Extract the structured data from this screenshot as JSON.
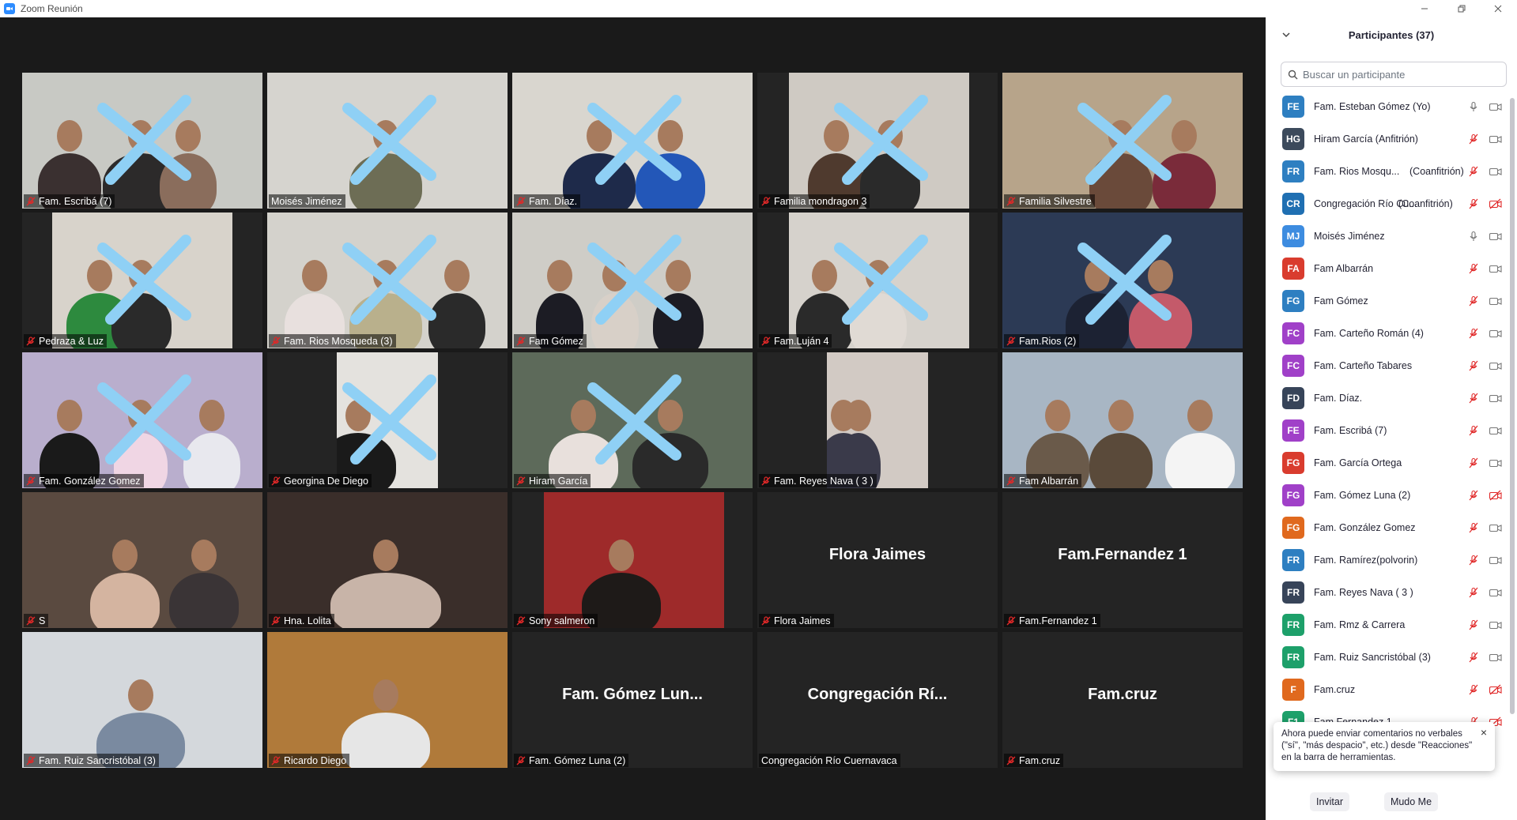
{
  "window": {
    "title": "Zoom Reunión"
  },
  "tiles": [
    {
      "label": "Fam. Escribá (7)",
      "muted": true,
      "kind": "video"
    },
    {
      "label": "Moisés Jiménez",
      "muted": false,
      "kind": "video"
    },
    {
      "label": "Fam. Díaz.",
      "muted": true,
      "kind": "video"
    },
    {
      "label": "Familia mondragon 3",
      "muted": true,
      "kind": "video"
    },
    {
      "label": "Familia  Silvestre",
      "muted": true,
      "kind": "video"
    },
    {
      "label": "Pedraza & Luz",
      "muted": true,
      "kind": "video"
    },
    {
      "label": "Fam. Rios Mosqueda (3)",
      "muted": true,
      "kind": "video"
    },
    {
      "label": "Fam Gómez",
      "muted": true,
      "kind": "video"
    },
    {
      "label": "Fam.Luján 4",
      "muted": true,
      "kind": "video"
    },
    {
      "label": "Fam.Rios (2)",
      "muted": true,
      "kind": "video"
    },
    {
      "label": "Fam. González Gomez",
      "muted": true,
      "kind": "video"
    },
    {
      "label": "Georgina De Diego",
      "muted": true,
      "kind": "video"
    },
    {
      "label": "Hiram García",
      "muted": true,
      "kind": "video"
    },
    {
      "label": "Fam. Reyes Nava ( 3 )",
      "muted": true,
      "kind": "video"
    },
    {
      "label": "Fam Albarrán",
      "muted": true,
      "kind": "video"
    },
    {
      "label": "S",
      "muted": true,
      "kind": "video"
    },
    {
      "label": "Hna. Lolita",
      "muted": true,
      "kind": "video"
    },
    {
      "label": "Sony salmeron",
      "muted": true,
      "kind": "video"
    },
    {
      "label": "Flora Jaimes",
      "muted": true,
      "kind": "name",
      "bigname": "Flora Jaimes"
    },
    {
      "label": "Fam.Fernandez 1",
      "muted": true,
      "kind": "name",
      "bigname": "Fam.Fernandez 1"
    },
    {
      "label": "Fam. Ruiz Sancristóbal (3)",
      "muted": true,
      "kind": "video"
    },
    {
      "label": "Ricardo Diego",
      "muted": true,
      "kind": "video"
    },
    {
      "label": "Fam. Gómez Luna (2)",
      "muted": true,
      "kind": "name",
      "bigname": "Fam.  Gómez  Lun..."
    },
    {
      "label": "Congregación Río Cuernavaca",
      "muted": false,
      "kind": "name",
      "bigname": "Congregación  Rí..."
    },
    {
      "label": "Fam.cruz",
      "muted": true,
      "kind": "name",
      "bigname": "Fam.cruz"
    }
  ],
  "panel": {
    "title": "Participantes (37)",
    "search_placeholder": "Buscar un participante",
    "participants": [
      {
        "initials": "FE",
        "color": "#2e7fc1",
        "name": "Fam. Esteban Gómez (Yo)",
        "role": "",
        "mic": "on",
        "cam": "on"
      },
      {
        "initials": "HG",
        "color": "#3c4a5c",
        "name": "Hiram García (Anfitrión)",
        "role": "",
        "mic": "muted",
        "cam": "on"
      },
      {
        "initials": "FR",
        "color": "#2e7fc1",
        "name": "Fam. Rios Mosqu...",
        "role": "(Coanfitrión)",
        "mic": "muted",
        "cam": "on"
      },
      {
        "initials": "CR",
        "color": "#1f6fb2",
        "name": "Congregación Río Cu...",
        "role": "(Coanfitrión)",
        "mic": "muted",
        "cam": "off"
      },
      {
        "initials": "MJ",
        "color": "#3d8ce0",
        "name": "Moisés Jiménez",
        "role": "",
        "mic": "on",
        "cam": "on"
      },
      {
        "initials": "FA",
        "color": "#d93c2e",
        "name": "Fam Albarrán",
        "role": "",
        "mic": "muted",
        "cam": "on"
      },
      {
        "initials": "FG",
        "color": "#2e7fc1",
        "name": "Fam Gómez",
        "role": "",
        "mic": "muted",
        "cam": "on"
      },
      {
        "initials": "FC",
        "color": "#a040c8",
        "name": "Fam. Carteño Román (4)",
        "role": "",
        "mic": "muted",
        "cam": "on"
      },
      {
        "initials": "FC",
        "color": "#a040c8",
        "name": "Fam. Carteño Tabares",
        "role": "",
        "mic": "muted",
        "cam": "on"
      },
      {
        "initials": "FD",
        "color": "#374459",
        "name": "Fam. Díaz.",
        "role": "",
        "mic": "muted",
        "cam": "on"
      },
      {
        "initials": "FE",
        "color": "#a040c8",
        "name": "Fam. Escribá (7)",
        "role": "",
        "mic": "muted",
        "cam": "on"
      },
      {
        "initials": "FG",
        "color": "#d93c2e",
        "name": "Fam. García Ortega",
        "role": "",
        "mic": "muted",
        "cam": "on"
      },
      {
        "initials": "FG",
        "color": "#a040c8",
        "name": "Fam. Gómez Luna (2)",
        "role": "",
        "mic": "muted",
        "cam": "off"
      },
      {
        "initials": "FG",
        "color": "#e0691e",
        "name": "Fam. González Gomez",
        "role": "",
        "mic": "muted",
        "cam": "on"
      },
      {
        "initials": "FR",
        "color": "#2e7fc1",
        "name": "Fam. Ramírez(polvorin)",
        "role": "",
        "mic": "muted",
        "cam": "on"
      },
      {
        "initials": "FR",
        "color": "#374459",
        "name": "Fam. Reyes Nava ( 3 )",
        "role": "",
        "mic": "muted",
        "cam": "on"
      },
      {
        "initials": "FR",
        "color": "#1da06a",
        "name": "Fam. Rmz & Carrera",
        "role": "",
        "mic": "muted",
        "cam": "on"
      },
      {
        "initials": "FR",
        "color": "#1da06a",
        "name": "Fam. Ruiz Sancristóbal (3)",
        "role": "",
        "mic": "muted",
        "cam": "on"
      },
      {
        "initials": "F",
        "color": "#e0691e",
        "name": "Fam.cruz",
        "role": "",
        "mic": "muted",
        "cam": "off"
      },
      {
        "initials": "F1",
        "color": "#1da06a",
        "name": "Fam.Fernandez 1",
        "role": "",
        "mic": "muted",
        "cam": "off"
      }
    ],
    "toast": {
      "text": "Ahora puede enviar comentarios no verbales (\"sí\", \"más despacio\", etc.) desde \"Reacciones\" en la barra de herramientas.",
      "close": "×"
    },
    "invite_label": "Invitar",
    "mute_me_label": "Mudo Me"
  },
  "colors": {
    "mute_red": "#e02828",
    "tile_bg": "#242424",
    "stage_bg": "#1a1a1a",
    "crossout": "#8fd0f5"
  }
}
